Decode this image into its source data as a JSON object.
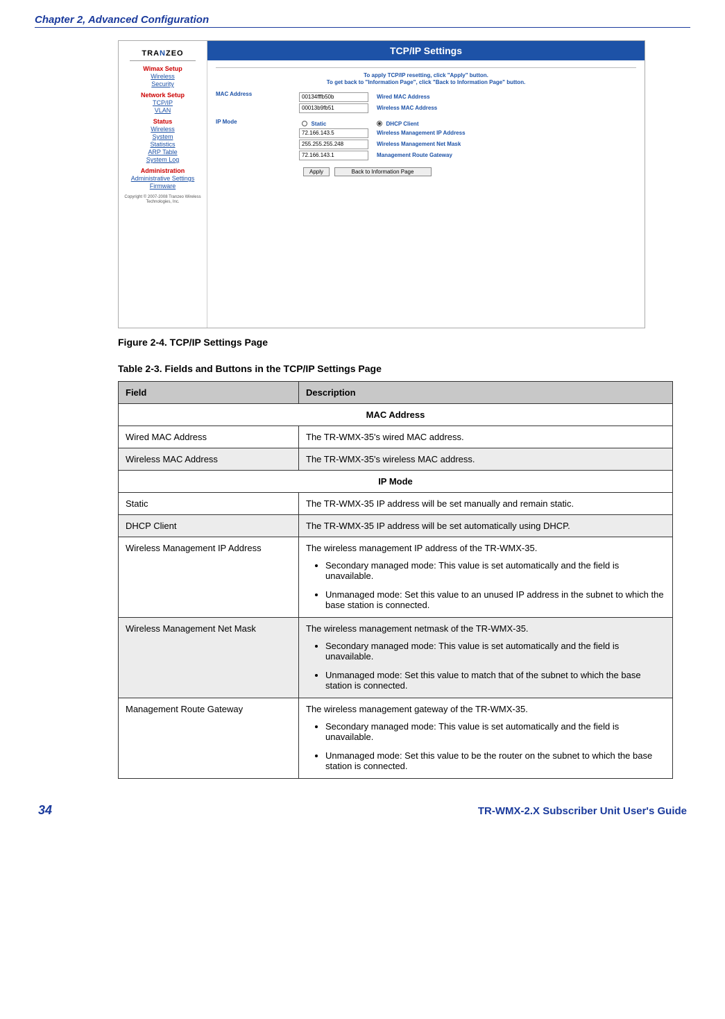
{
  "header": {
    "chapter": "Chapter 2, Advanced Configuration"
  },
  "screenshot": {
    "logo": {
      "pre": "TRA",
      "mid": "N",
      "post": "ZEO"
    },
    "sidebar": {
      "groups": [
        {
          "title": "Wimax Setup",
          "links": [
            "Wireless",
            "Security"
          ]
        },
        {
          "title": "Network Setup",
          "links": [
            "TCP/IP",
            "VLAN"
          ]
        },
        {
          "title": "Status",
          "links": [
            "Wireless",
            "System",
            "Statistics",
            "ARP Table",
            "System Log"
          ]
        },
        {
          "title": "Administration",
          "links": [
            "Administrative Settings",
            "Firmware"
          ]
        }
      ],
      "copyright": "Copyright © 2007-2008 Tranzeo Wireless Technologies, Inc."
    },
    "panel_title": "TCP/IP Settings",
    "instructions": {
      "l1": "To apply TCP/IP resetting, click \"Apply\" button.",
      "l2": "To get back to \"Information Page\", click \"Back to Information Page\" button."
    },
    "mac": {
      "label": "MAC Address",
      "rows": [
        {
          "value": "00134fffb50b",
          "desc": "Wired MAC Address"
        },
        {
          "value": "00013b9fb51",
          "desc": "Wireless MAC Address"
        }
      ]
    },
    "ip": {
      "label": "IP Mode",
      "static": "Static",
      "dhcp": "DHCP Client",
      "rows": [
        {
          "value": "72.166.143.5",
          "desc": "Wireless Management IP Address"
        },
        {
          "value": "255.255.255.248",
          "desc": "Wireless Management Net Mask"
        },
        {
          "value": "72.166.143.1",
          "desc": "Management Route Gateway"
        }
      ]
    },
    "buttons": {
      "apply": "Apply",
      "back": "Back to Information Page"
    }
  },
  "captions": {
    "figure": "Figure 2-4. TCP/IP Settings Page",
    "table": "Table 2-3. Fields and Buttons in the TCP/IP Settings Page"
  },
  "table": {
    "headers": {
      "field": "Field",
      "desc": "Description"
    },
    "sections": [
      {
        "title": "MAC Address",
        "rows": [
          {
            "alt": false,
            "field": "Wired MAC Address",
            "desc": "The TR-WMX-35's wired MAC address."
          },
          {
            "alt": true,
            "field": "Wireless MAC Address",
            "desc": "The TR-WMX-35's wireless MAC address."
          }
        ]
      },
      {
        "title": "IP Mode",
        "rows": [
          {
            "alt": false,
            "field": "Static",
            "desc": "The TR-WMX-35 IP address will be set manually and remain static."
          },
          {
            "alt": true,
            "field": "DHCP Client",
            "desc": "The TR-WMX-35 IP address will be set automatically using DHCP."
          },
          {
            "alt": false,
            "field": "Wireless Management IP Address",
            "desc": "The wireless management IP address of the TR-WMX-35.",
            "bullets": [
              "Secondary managed mode: This value is set automatically and the field is unavailable.",
              "Unmanaged mode: Set this value to an unused IP address in the subnet to which the base station is connected."
            ]
          },
          {
            "alt": true,
            "field": "Wireless Management Net Mask",
            "desc": "The wireless management netmask of the TR-WMX-35.",
            "bullets": [
              "Secondary managed mode: This value is set automatically and the field is unavailable.",
              "Unmanaged mode: Set this value to match that of the subnet to which the base station is connected."
            ]
          },
          {
            "alt": false,
            "field": "Management Route Gateway",
            "desc": "The wireless management gateway of the TR-WMX-35.",
            "bullets": [
              "Secondary managed mode: This value is set automatically and the field is unavailable.",
              "Unmanaged mode: Set this value to be the router on the subnet to which the base station is connected."
            ]
          }
        ]
      }
    ]
  },
  "footer": {
    "page": "34",
    "guide": "TR-WMX-2.X Subscriber Unit User's Guide"
  }
}
